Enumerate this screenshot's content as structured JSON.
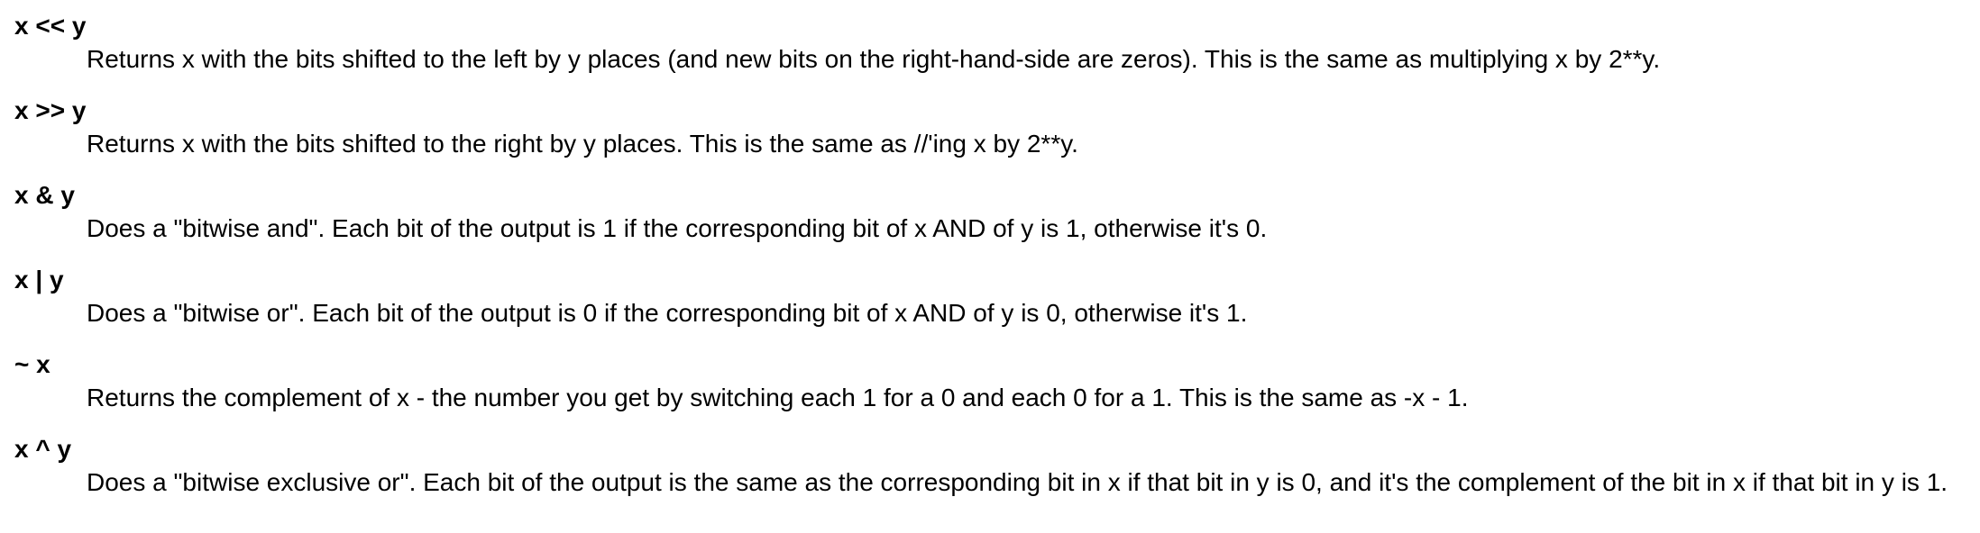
{
  "operators": [
    {
      "term": "x << y",
      "description": "Returns x with the bits shifted to the left by y places (and new bits on the right-hand-side are zeros). This is the same as multiplying x by 2**y."
    },
    {
      "term": "x >> y",
      "description": "Returns x with the bits shifted to the right by y places. This is the same as //'ing x by 2**y."
    },
    {
      "term": "x & y",
      "description": "Does a \"bitwise and\". Each bit of the output is 1 if the corresponding bit of x AND of y is 1, otherwise it's 0."
    },
    {
      "term": "x | y",
      "description": "Does a \"bitwise or\". Each bit of the output is 0 if the corresponding bit of x AND of y is 0, otherwise it's 1."
    },
    {
      "term": "~ x",
      "description": "Returns the complement of x - the number you get by switching each 1 for a 0 and each 0 for a 1. This is the same as -x - 1."
    },
    {
      "term": "x ^ y",
      "description": "Does a \"bitwise exclusive or\". Each bit of the output is the same as the corresponding bit in x if that bit in y is 0, and it's the complement of the bit in x if that bit in y is 1."
    }
  ]
}
